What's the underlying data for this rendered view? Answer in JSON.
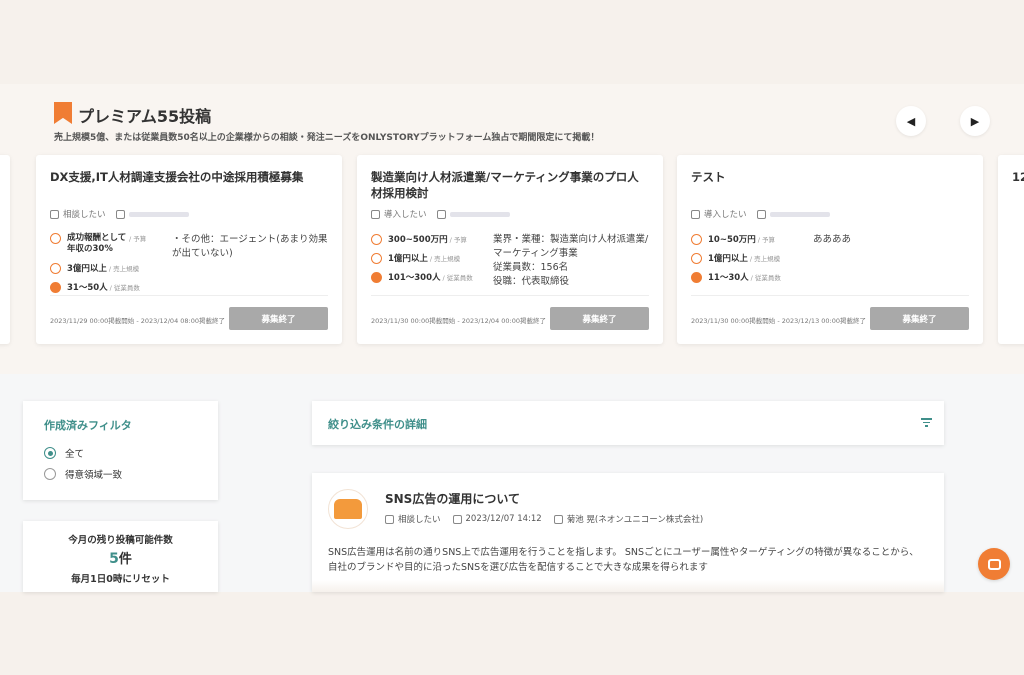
{
  "premium": {
    "title": "プレミアム55投稿",
    "subtitle": "売上規模5億、または従業員数50名以上の企業様からの相談・発注ニーズをONLYSTORYプラットフォーム独占で期間限定にて掲載！",
    "prev_icon": "◀",
    "next_icon": "▶"
  },
  "cards": [
    {
      "title": "DX支援,IT人材調達支援会社の中途採用積極募集",
      "type": "相談したい",
      "stats": [
        {
          "value": "成功報酬として年収の30%",
          "label": "/ 予算"
        },
        {
          "value": "3億円以上",
          "label": "/ 売上規模"
        },
        {
          "value": "31〜50人",
          "label": "/ 従業員数"
        }
      ],
      "desc": "・その他：エージェント(あまり効果が出ていない)",
      "period": "2023/11/29 00:00掲載開始 - 2023/12/04 08:00掲載終了",
      "status": "募集終了"
    },
    {
      "title": "製造業向け人材派遣業/マーケティング事業のプロ人材採用検討",
      "type": "導入したい",
      "stats": [
        {
          "value": "300~500万円",
          "label": "/ 予算"
        },
        {
          "value": "1億円以上",
          "label": "/ 売上規模"
        },
        {
          "value": "101〜300人",
          "label": "/ 従業員数"
        }
      ],
      "desc": "業界・業種：製造業向け人材派遣業/マーケティング事業\n従業員数：156名\n役職：代表取締役",
      "period": "2023/11/30 00:00掲載開始 - 2023/12/04 00:00掲載終了",
      "status": "募集終了"
    },
    {
      "title": "テスト",
      "type": "導入したい",
      "stats": [
        {
          "value": "10~50万円",
          "label": "/ 予算"
        },
        {
          "value": "1億円以上",
          "label": "/ 売上規模"
        },
        {
          "value": "11〜30人",
          "label": "/ 従業員数"
        }
      ],
      "desc": "ああああ",
      "period": "2023/11/30 00:00掲載開始 - 2023/12/13 00:00掲載終了",
      "status": "募集終了"
    }
  ],
  "filter": {
    "title": "作成済みフィルタ",
    "options": [
      "全て",
      "得意領域一致"
    ]
  },
  "quota": {
    "label": "今月の残り投稿可能件数",
    "count": "5",
    "unit": "件",
    "reset": "毎月1日0時にリセット"
  },
  "detail": {
    "title": "絞り込み条件の詳細"
  },
  "post": {
    "title": "SNS広告の運用について",
    "type": "相談したい",
    "date": "2023/12/07 14:12",
    "author": "菊池 晃(ネオンユニコーン株式会社)",
    "body": "SNS広告運用は名前の通りSNS上で広告運用を行うことを指します。 SNSごとにユーザー属性やターゲティングの特徴が異なることから、自社のブランドや目的に沿ったSNSを選び広告を配信することで大きな成果を得られます"
  },
  "partial_card": {
    "title_fragment": "12"
  }
}
